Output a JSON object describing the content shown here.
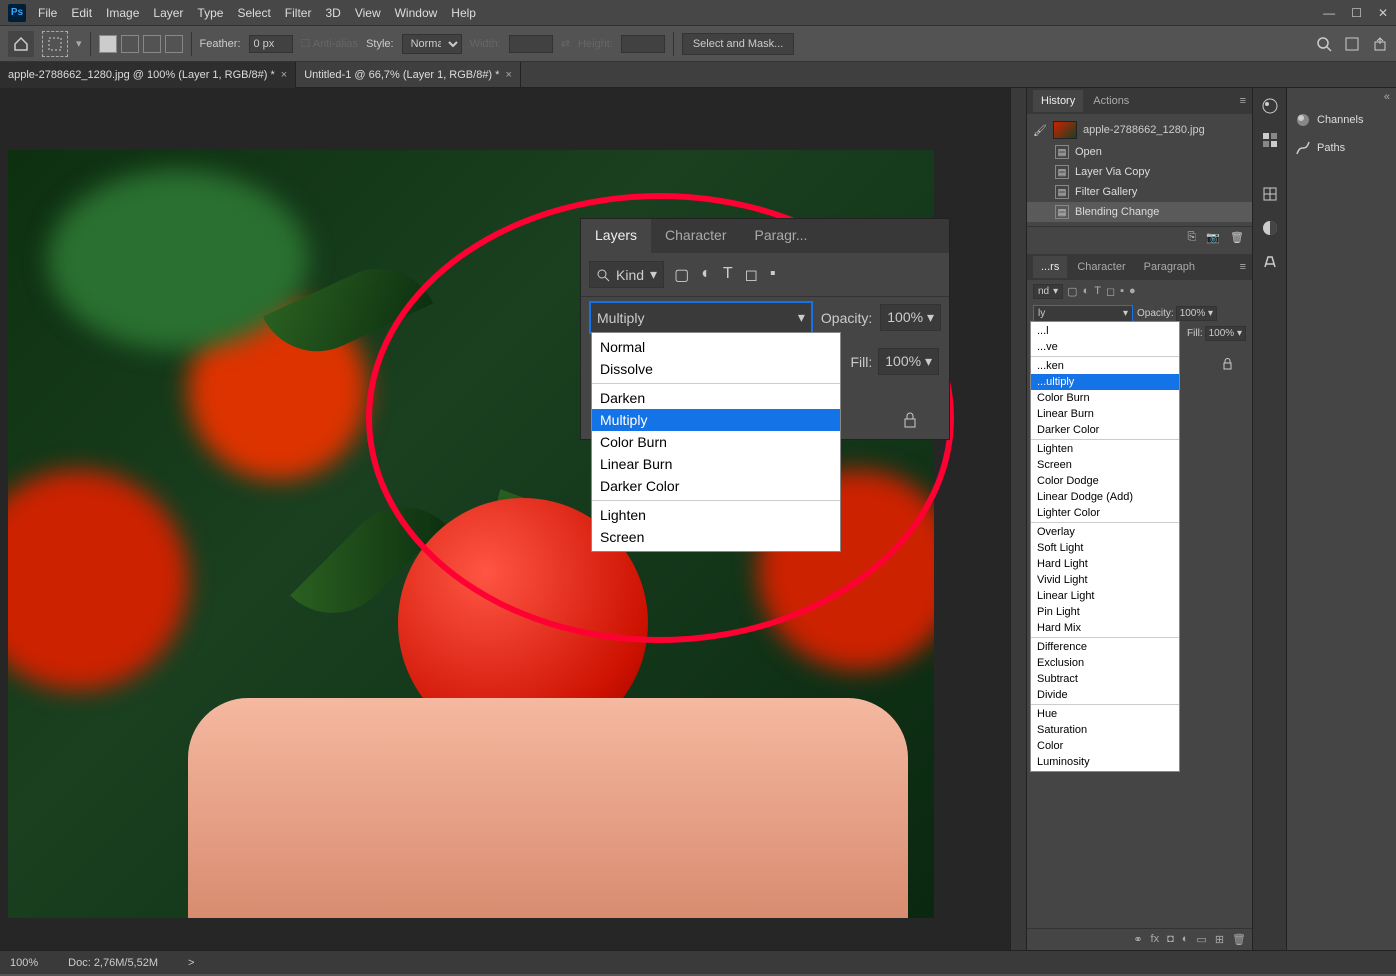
{
  "menu": {
    "items": [
      "File",
      "Edit",
      "Image",
      "Layer",
      "Type",
      "Select",
      "Filter",
      "3D",
      "View",
      "Window",
      "Help"
    ]
  },
  "options_bar": {
    "feather_label": "Feather:",
    "feather_value": "0 px",
    "antialias": "Anti-alias",
    "style_label": "Style:",
    "style_value": "Normal",
    "width_label": "Width:",
    "height_label": "Height:",
    "select_mask": "Select and Mask..."
  },
  "doc_tabs": [
    {
      "label": "apple-2788662_1280.jpg @ 100% (Layer 1, RGB/8#) *"
    },
    {
      "label": "Untitled-1 @ 66,7% (Layer 1, RGB/8#) *"
    }
  ],
  "zoom_panel": {
    "tabs": [
      "Layers",
      "Character",
      "Paragr..."
    ],
    "kind_label": "Kind",
    "blend_value": "Multiply",
    "opacity_label": "Opacity:",
    "opacity_value": "100%",
    "fill_label": "Fill:",
    "fill_value": "100%",
    "dropdown_groups": [
      [
        "Normal",
        "Dissolve"
      ],
      [
        "Darken",
        "Multiply",
        "Color Burn",
        "Linear Burn",
        "Darker Color"
      ],
      [
        "Lighten",
        "Screen"
      ]
    ],
    "dropdown_selected": "Multiply"
  },
  "history_panel": {
    "tabs": [
      "History",
      "Actions"
    ],
    "doc": "apple-2788662_1280.jpg",
    "items": [
      "Open",
      "Layer Via Copy",
      "Filter Gallery",
      "Blending Change"
    ]
  },
  "layers_panel": {
    "tabs": [
      "...rs",
      "Character",
      "Paragraph"
    ],
    "kind_short": "nd",
    "blend_short": "ly",
    "opacity_label": "Opacity:",
    "opacity_value": "100%",
    "fill_label": "Fill:",
    "fill_value": "100%",
    "dropdown_groups": [
      [
        "...l",
        "...ve"
      ],
      [
        "...ken",
        "...ultiply",
        "Color Burn",
        "Linear Burn",
        "Darker Color"
      ],
      [
        "Lighten",
        "Screen",
        "Color Dodge",
        "Linear Dodge (Add)",
        "Lighter Color"
      ],
      [
        "Overlay",
        "Soft Light",
        "Hard Light",
        "Vivid Light",
        "Linear Light",
        "Pin Light",
        "Hard Mix"
      ],
      [
        "Difference",
        "Exclusion",
        "Subtract",
        "Divide"
      ],
      [
        "Hue",
        "Saturation",
        "Color",
        "Luminosity"
      ]
    ],
    "dropdown_selected": "...ultiply"
  },
  "collapsed_panels": [
    "Channels",
    "Paths"
  ],
  "status_bar": {
    "zoom": "100%",
    "doc": "Doc: 2,76M/5,52M",
    "arrow": ">"
  }
}
